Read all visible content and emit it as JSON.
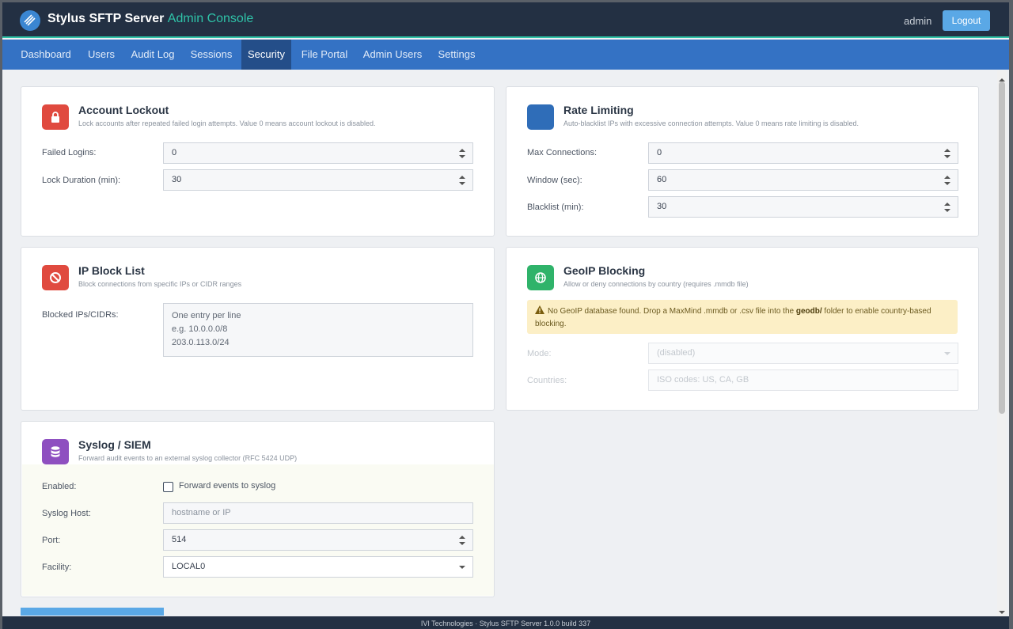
{
  "header": {
    "brand_name": "Stylus SFTP Server",
    "brand_suffix": "Admin Console",
    "user": "admin",
    "logout_label": "Logout"
  },
  "nav": {
    "tabs": [
      "Dashboard",
      "Users",
      "Audit Log",
      "Sessions",
      "Security",
      "File Portal",
      "Admin Users",
      "Settings"
    ],
    "active": "Security"
  },
  "account_lockout": {
    "title": "Account Lockout",
    "subtitle": "Lock accounts after repeated failed login attempts. Value 0 means account lockout is disabled.",
    "failed_logins_label": "Failed Logins:",
    "failed_logins_value": "0",
    "lock_duration_label": "Lock Duration (min):",
    "lock_duration_value": "30"
  },
  "rate_limiting": {
    "title": "Rate Limiting",
    "subtitle": "Auto-blacklist IPs with excessive connection attempts. Value 0 means rate limiting is disabled.",
    "max_connections_label": "Max Connections:",
    "max_connections_value": "0",
    "window_label": "Window (sec):",
    "window_value": "60",
    "blacklist_label": "Blacklist (min):",
    "blacklist_value": "30"
  },
  "ip_block": {
    "title": "IP Block List",
    "subtitle": "Block connections from specific IPs or CIDR ranges",
    "label": "Blocked IPs/CIDRs:",
    "placeholder_line1": "One entry per line",
    "placeholder_line2": "e.g. 10.0.0.0/8",
    "placeholder_line3": "203.0.113.0/24"
  },
  "geoip": {
    "title": "GeoIP Blocking",
    "subtitle": "Allow or deny connections by country (requires .mmdb file)",
    "warning_prefix": "No GeoIP database found. Drop a MaxMind .mmdb or .csv file into the ",
    "warning_folder": "geodb/",
    "warning_suffix": " folder to enable country-based blocking.",
    "mode_label": "Mode:",
    "mode_value": "(disabled)",
    "countries_label": "Countries:",
    "countries_placeholder": "ISO codes: US, CA, GB"
  },
  "syslog": {
    "title": "Syslog / SIEM",
    "subtitle": "Forward audit events to an external syslog collector (RFC 5424 UDP)",
    "enabled_label": "Enabled:",
    "checkbox_label": "Forward events to syslog",
    "checked": false,
    "host_label": "Syslog Host:",
    "host_placeholder": "hostname or IP",
    "port_label": "Port:",
    "port_value": "514",
    "facility_label": "Facility:",
    "facility_value": "LOCAL0"
  },
  "footer": {
    "text": "IVI Technologies  ·  Stylus SFTP Server 1.0.0 build 337"
  },
  "colors": {
    "topbar": "#233043",
    "nav": "#3472c4",
    "nav_active": "#244e89",
    "accent": "#2fc3a8",
    "lockout_icon": "#e04a3f",
    "rate_icon": "#2f6db8",
    "block_icon": "#e04a3f",
    "geoip_icon": "#2fb36a",
    "syslog_icon": "#8e4fc0",
    "warning_bg": "#fcefc6"
  },
  "icons": {
    "logo": "stylus-logo-icon",
    "lockout": "lock-icon",
    "rate": "speed-icon",
    "block": "ban-icon",
    "geoip": "globe-icon",
    "syslog": "database-icon",
    "warning": "warning-icon"
  }
}
